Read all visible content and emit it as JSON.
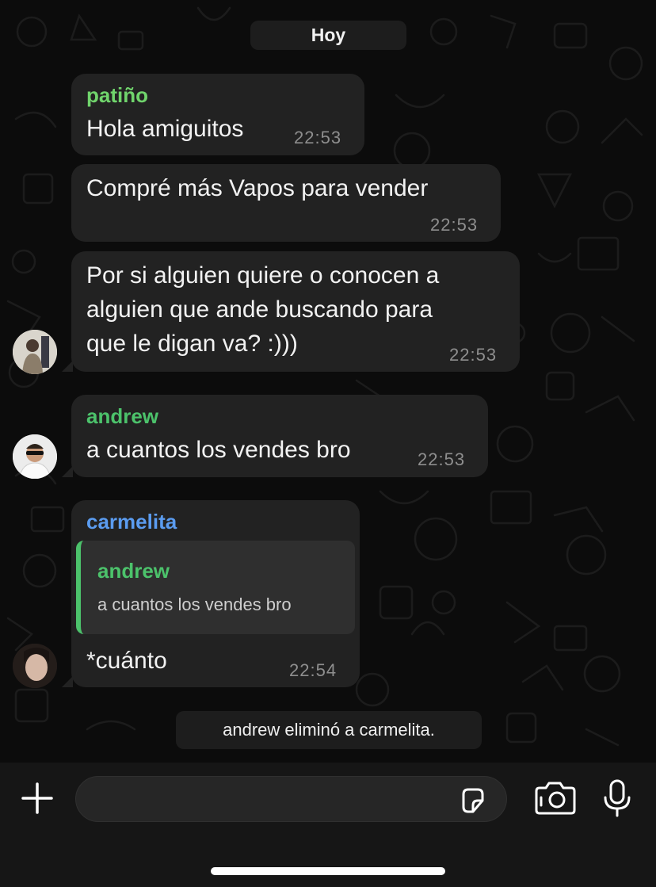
{
  "chat": {
    "date_label": "Hoy",
    "messages": [
      {
        "sender": "patiño",
        "sender_color": "#70d46c",
        "text": "Hola amiguitos",
        "time": "22:53"
      },
      {
        "text": "Compré más Vapos para vender",
        "time": "22:53"
      },
      {
        "lines": [
          "Por si alguien quiere o conocen a",
          "alguien que ande buscando para",
          "que le digan va? :)))"
        ],
        "time": "22:53"
      },
      {
        "sender": "andrew",
        "sender_color": "#4cc26b",
        "text": "a cuantos los vendes bro",
        "time": "22:53"
      },
      {
        "sender": "carmelita",
        "sender_color": "#5b9cf0",
        "reply": {
          "sender": "andrew",
          "text": "a cuantos los vendes bro"
        },
        "text": "*cuánto",
        "time": "22:54"
      }
    ],
    "system_message": "andrew eliminó a carmelita."
  },
  "composer": {
    "placeholder": "",
    "icons": [
      "plus-icon",
      "sticker-icon",
      "camera-icon",
      "microphone-icon"
    ]
  },
  "colors": {
    "background": "#0b0b0b",
    "bubble": "#222222",
    "patino": "#70d46c",
    "andrew": "#4cc26b",
    "carmelita": "#5b9cf0"
  }
}
